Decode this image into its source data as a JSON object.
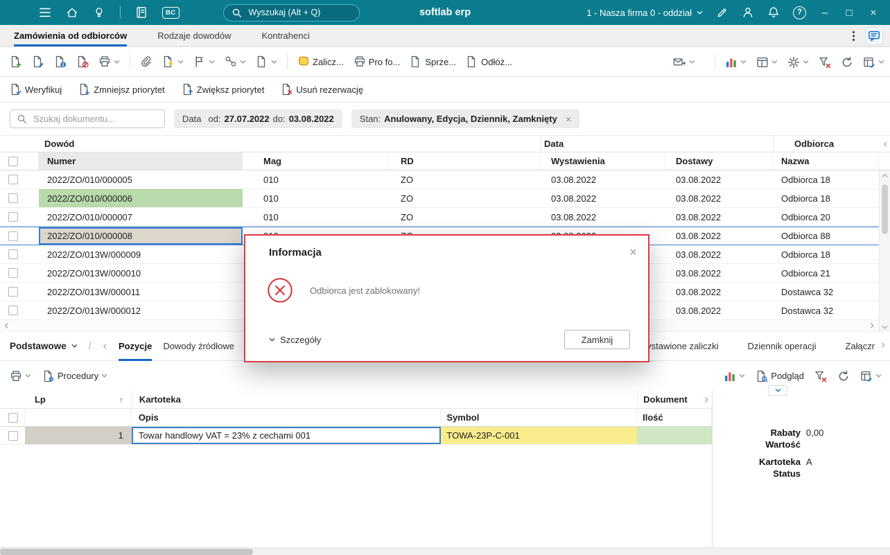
{
  "topbar": {
    "search_placeholder": "Wyszukaj (Alt + Q)",
    "app_title": "softlab erp",
    "company": "1 - Nasza firma 0 - oddział",
    "bc_label": "BC",
    "help_glyph": "?",
    "minimize_glyph": "–",
    "maximize_glyph": "□",
    "close_glyph": "×"
  },
  "tabs": {
    "items": [
      "Zamówienia od odbiorców",
      "Rodzaje dowodów",
      "Kontrahenci"
    ],
    "active": "Zamówienia od odbiorców"
  },
  "toolbar_main": {
    "labeled_buttons": [
      "Zalicz...",
      "Pro fo...",
      "Sprze...",
      "Odłóż..."
    ]
  },
  "toolbar_actions": {
    "buttons": [
      "Weryfikuj",
      "Zmniejsz priorytet",
      "Zwiększ priorytet",
      "Usuń rezerwację"
    ]
  },
  "filters": {
    "search_placeholder": "Szukaj dokumentu...",
    "date_label": "Data",
    "from_label": "od:",
    "date_from": "27.07.2022",
    "to_label": "do:",
    "date_to": "03.08.2022",
    "state_label": "Stan:",
    "state_value": "Anulowany, Edycja, Dziennik, Zamknięty",
    "remove_glyph": "×"
  },
  "orders_grid": {
    "groups": [
      "Dowód",
      "Data",
      "Odbiorca"
    ],
    "columns": [
      "Numer",
      "Mag",
      "RD",
      "Wystawienia",
      "Dostawy",
      "Nazwa"
    ],
    "rows": [
      {
        "numer": "2022/ZO/010/000005",
        "mag": "010",
        "rd": "ZO",
        "wystawienia": "03.08.2022",
        "dostawy": "03.08.2022",
        "nazwa": "Odbiorca 18"
      },
      {
        "numer": "2022/ZO/010/000006",
        "mag": "010",
        "rd": "ZO",
        "wystawienia": "03.08.2022",
        "dostawy": "03.08.2022",
        "nazwa": "Odbiorca 18",
        "highlight": "green"
      },
      {
        "numer": "2022/ZO/010/000007",
        "mag": "010",
        "rd": "ZO",
        "wystawienia": "03.08.2022",
        "dostawy": "03.08.2022",
        "nazwa": "Odbiorca 20"
      },
      {
        "numer": "2022/ZO/010/000008",
        "mag": "010",
        "rd": "ZO",
        "wystawienia": "03.08.2022",
        "dostawy": "03.08.2022",
        "nazwa": "Odbiorca 88",
        "selected": true
      },
      {
        "numer": "2022/ZO/013W/000009",
        "mag": "",
        "rd": "",
        "wystawienia": "",
        "dostawy": "03.08.2022",
        "nazwa": "Odbiorca 18"
      },
      {
        "numer": "2022/ZO/013W/000010",
        "mag": "",
        "rd": "",
        "wystawienia": "",
        "dostawy": "03.08.2022",
        "nazwa": "Odbiorca 21"
      },
      {
        "numer": "2022/ZO/013W/000011",
        "mag": "",
        "rd": "",
        "wystawienia": "",
        "dostawy": "03.08.2022",
        "nazwa": "Dostawca 32"
      },
      {
        "numer": "2022/ZO/013W/000012",
        "mag": "",
        "rd": "",
        "wystawienia": "",
        "dostawy": "03.08.2022",
        "nazwa": "Dostawca 32"
      }
    ]
  },
  "section_tabs": {
    "view_label": "Podstawowe",
    "separator_glyph": "/",
    "tabs_left": [
      "Pozycje",
      "Dowody źródłowe"
    ],
    "tabs_right": [
      "Wystawione zaliczki",
      "Dziennik operacji",
      "Załączniki"
    ],
    "active": "Pozycje"
  },
  "positions_toolbar": {
    "procedures_label": "Procedury",
    "preview_label": "Podgląd"
  },
  "positions_grid": {
    "groups": [
      "Lp",
      "Kartoteka",
      "Dokument"
    ],
    "columns": [
      "Opis",
      "Symbol",
      "Ilość"
    ],
    "sort_glyph": "↑",
    "rows": [
      {
        "lp": "1",
        "opis": "Towar handlowy VAT = 23% z cechami 001",
        "symbol": "TOWA-23P-C-001",
        "ilosc": ""
      }
    ]
  },
  "details_panel": {
    "fields": [
      {
        "label": "Rabaty",
        "value": "0,00"
      },
      {
        "label": "Wartość",
        "value": ""
      },
      {
        "label": "Kartoteka",
        "value": "A"
      },
      {
        "label": "Status",
        "value": ""
      }
    ]
  },
  "dialog": {
    "title": "Informacja",
    "message": "Odbiorca jest zablokowany!",
    "details_label": "Szczegóły",
    "close_label": "Zamknij",
    "close_glyph": "×"
  },
  "colors": {
    "topbar": "#0a7c8e",
    "accent": "#1269c7",
    "alert": "#dc3b40",
    "row_highlight_green": "#b9daaa",
    "cell_yellow": "#f8ec8d",
    "cell_green": "#cfe7c3",
    "selection": "#3c80d0"
  }
}
